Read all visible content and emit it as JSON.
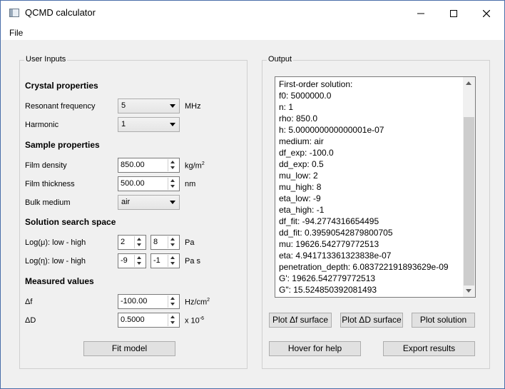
{
  "window": {
    "title": "QCMD calculator"
  },
  "menu": {
    "file": "File"
  },
  "inputs": {
    "group_title": "User Inputs",
    "crystal": {
      "heading": "Crystal properties",
      "resonant_label": "Resonant frequency",
      "resonant_value": "5",
      "resonant_unit": "MHz",
      "harmonic_label": "Harmonic",
      "harmonic_value": "1"
    },
    "sample": {
      "heading": "Sample properties",
      "density_label": "Film density",
      "density_value": "850.00",
      "density_unit": "kg/m",
      "density_unit_sup": "2",
      "thickness_label": "Film thickness",
      "thickness_value": "500.00",
      "thickness_unit": "nm",
      "medium_label": "Bulk medium",
      "medium_value": "air"
    },
    "search": {
      "heading": "Solution search space",
      "mu_label": "Log(μ): low - high",
      "mu_low": "2",
      "mu_high": "8",
      "mu_unit": "Pa",
      "eta_label": "Log(η): low - high",
      "eta_low": "-9",
      "eta_high": "-1",
      "eta_unit": "Pa s"
    },
    "measured": {
      "heading": "Measured values",
      "df_label": "Δf",
      "df_value": "-100.00",
      "df_unit": "Hz/cm",
      "df_unit_sup": "2",
      "dd_label": "ΔD",
      "dd_value": "0.5000",
      "dd_unit": "x 10",
      "dd_unit_sup": "-6"
    },
    "fit_button": "Fit model"
  },
  "output": {
    "group_title": "Output",
    "lines": [
      "First-order solution:",
      "f0: 5000000.0",
      "n: 1",
      "rho: 850.0",
      "h: 5.000000000000001e-07",
      "medium: air",
      "df_exp: -100.0",
      "dd_exp: 0.5",
      "mu_low: 2",
      "mu_high: 8",
      "eta_low: -9",
      "eta_high: -1",
      "df_fit: -94.2774316654495",
      "dd_fit: 0.39590542879800705",
      "mu: 19626.542779772513",
      "eta: 4.941713361323838e-07",
      "penetration_depth: 6.083722191893629e-09",
      "G': 19626.542779772513",
      "G\": 15.524850392081493"
    ],
    "buttons": {
      "plot_df": "Plot Δf surface",
      "plot_dd": "Plot ΔD surface",
      "plot_solution": "Plot solution",
      "hover_help": "Hover for help",
      "export": "Export results"
    }
  },
  "icons": {
    "app": "app-window-icon",
    "minimize": "minimize-icon",
    "maximize": "maximize-icon",
    "close": "close-icon"
  }
}
